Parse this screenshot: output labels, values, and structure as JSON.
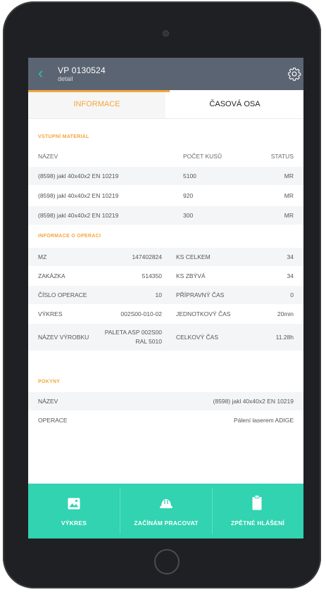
{
  "header": {
    "title": "VP 0130524",
    "subtitle": "detail"
  },
  "tabs": [
    {
      "label": "INFORMACE"
    },
    {
      "label": "ČASOVÁ OSA"
    }
  ],
  "input_material": {
    "title": "VSTUPNÍ MATERIÁL",
    "columns": [
      "NÁZEV",
      "POČET KUSŮ",
      "STATUS"
    ],
    "rows": [
      {
        "name": "(8598) jakl 40x40x2 EN 10219",
        "count": "5100",
        "status": "MR"
      },
      {
        "name": "(8598) jakl 40x40x2 EN 10219",
        "count": "920",
        "status": "MR"
      },
      {
        "name": "(8598) jakl 40x40x2 EN 10219",
        "count": "300",
        "status": "MR"
      }
    ]
  },
  "operation_info": {
    "title": "INFORMACE O OPERACI",
    "rows": [
      {
        "k1": "MZ",
        "v1": "147402824",
        "k2": "KS CELKEM",
        "v2": "34"
      },
      {
        "k1": "ZAKÁZKA",
        "v1": "514350",
        "k2": "KS ZBÝVÁ",
        "v2": "34"
      },
      {
        "k1": "ČÍSLO OPERACE",
        "v1": "10",
        "k2": "PŘÍPRAVNÝ ČAS",
        "v2": "0"
      },
      {
        "k1": "VÝKRES",
        "v1": "002S00-010-02",
        "k2": "JEDNOTKOVÝ ČAS",
        "v2": "20min"
      },
      {
        "k1": "NÁZEV VÝROBKU",
        "v1a": "PALETA ASP 002S00",
        "v1b": "RAL 5010",
        "k2": "CELKOVÝ ČAS",
        "v2": "11.28h"
      }
    ]
  },
  "instructions": {
    "title": "POKYNY",
    "rows": [
      {
        "key": "NÁZEV",
        "value": "(8598) jakl 40x40x2 EN 10219"
      },
      {
        "key": "OPERACE",
        "value": "Pálení laserem ADIGE"
      }
    ]
  },
  "footer": {
    "buttons": [
      {
        "label": "VÝKRES",
        "icon": "image-icon"
      },
      {
        "label": "ZAČÍNÁM PRACOVAT",
        "icon": "hard-hat-icon"
      },
      {
        "label": "ZPĚTNÉ HLÁŠENÍ",
        "icon": "clipboard-icon"
      }
    ]
  },
  "colors": {
    "accent": "#f4a63a",
    "header": "#5b6472",
    "footer": "#31d3b0",
    "back": "#2ec4a6"
  }
}
